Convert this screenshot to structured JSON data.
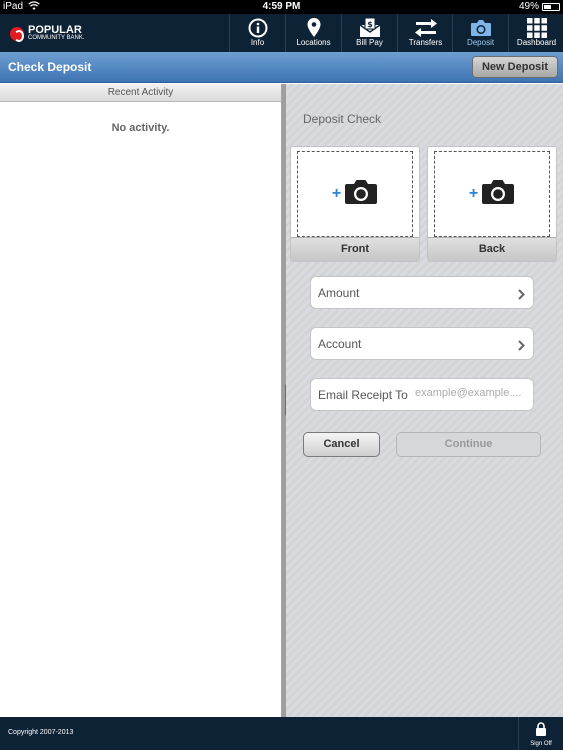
{
  "status_bar": {
    "carrier": "iPad",
    "time": "4:59 PM",
    "battery": "49%"
  },
  "brand": {
    "line1": "POPULAR",
    "line2": "COMMUNITY BANK."
  },
  "nav": {
    "items": [
      {
        "label": "Info",
        "icon": "info-icon"
      },
      {
        "label": "Locations",
        "icon": "map-pin-icon"
      },
      {
        "label": "Bill Pay",
        "icon": "bill-envelope-icon"
      },
      {
        "label": "Transfers",
        "icon": "transfer-arrows-icon"
      },
      {
        "label": "Deposit",
        "icon": "camera-icon",
        "active": true
      },
      {
        "label": "Dashboard",
        "icon": "grid-icon"
      }
    ]
  },
  "header": {
    "title": "Check Deposit",
    "new_deposit_label": "New Deposit"
  },
  "left_panel": {
    "section_title": "Recent Activity",
    "empty_text": "No activity."
  },
  "deposit": {
    "heading": "Deposit Check",
    "front_label": "Front",
    "back_label": "Back",
    "amount_label": "Amount",
    "account_label": "Account",
    "email_label": "Email Receipt To",
    "email_placeholder": "example@example....",
    "email_value": "",
    "cancel_label": "Cancel",
    "continue_label": "Continue"
  },
  "footer": {
    "copyright": "Copyright 2007-2013",
    "signoff_label": "Sign Off"
  },
  "colors": {
    "nav_bg": "#0e2235",
    "title_bar": "#4a80c0",
    "accent_plus": "#2b83d6"
  }
}
